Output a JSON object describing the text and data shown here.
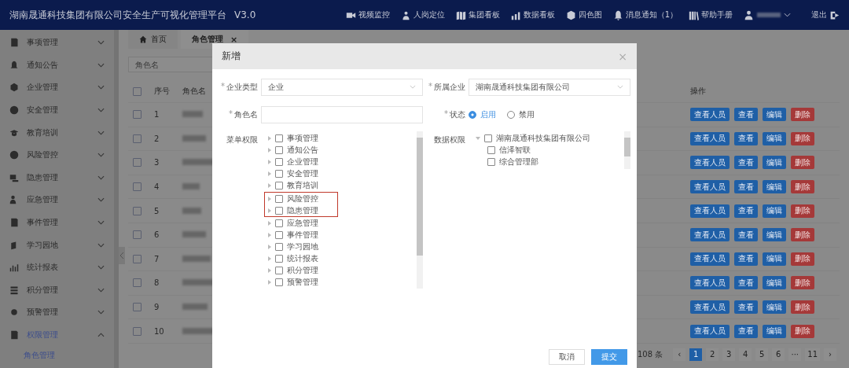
{
  "header": {
    "title": "湖南晟通科技集团有限公司安全生产可视化管理平台",
    "version": "V3.0",
    "nav": [
      {
        "label": "视频监控"
      },
      {
        "label": "人岗定位"
      },
      {
        "label": "集团看板"
      },
      {
        "label": "数据看板"
      },
      {
        "label": "四色图"
      },
      {
        "label": "消息通知（1）"
      },
      {
        "label": "帮助手册"
      }
    ],
    "logout": "退出"
  },
  "sidebar": {
    "items": [
      {
        "label": "事项管理",
        "expanded": false,
        "selected": false
      },
      {
        "label": "通知公告",
        "expanded": false,
        "selected": false
      },
      {
        "label": "企业管理",
        "expanded": false,
        "selected": false
      },
      {
        "label": "安全管理",
        "expanded": false,
        "selected": false
      },
      {
        "label": "教育培训",
        "expanded": false,
        "selected": false
      },
      {
        "label": "风险管控",
        "expanded": false,
        "selected": false
      },
      {
        "label": "隐患管理",
        "expanded": false,
        "selected": false
      },
      {
        "label": "应急管理",
        "expanded": false,
        "selected": false
      },
      {
        "label": "事件管理",
        "expanded": false,
        "selected": false
      },
      {
        "label": "学习园地",
        "expanded": false,
        "selected": false
      },
      {
        "label": "统计报表",
        "expanded": false,
        "selected": false
      },
      {
        "label": "积分管理",
        "expanded": false,
        "selected": false
      },
      {
        "label": "预警管理",
        "expanded": false,
        "selected": false
      },
      {
        "label": "权限管理",
        "expanded": true,
        "selected": true,
        "children": [
          {
            "label": "角色管理",
            "selected": true
          }
        ]
      }
    ]
  },
  "tabs": [
    {
      "label": "首页",
      "selected": false
    },
    {
      "label": "角色管理",
      "selected": true,
      "close": "×"
    }
  ],
  "search": {
    "placeholder": "角色名"
  },
  "table": {
    "all_checked": false,
    "columns": [
      "序号",
      "角色名",
      "操作"
    ],
    "rows": [
      {
        "index": "1",
        "checked": false,
        "actions": [
          {
            "label": "查看人员",
            "kind": "primary"
          },
          {
            "label": "查看",
            "kind": "primary"
          },
          {
            "label": "编辑",
            "kind": "primary"
          },
          {
            "label": "删除",
            "kind": "danger"
          }
        ]
      },
      {
        "index": "2",
        "checked": false,
        "actions": [
          {
            "label": "查看人员",
            "kind": "primary"
          },
          {
            "label": "查看",
            "kind": "primary"
          },
          {
            "label": "编辑",
            "kind": "primary"
          },
          {
            "label": "删除",
            "kind": "danger"
          }
        ]
      },
      {
        "index": "3",
        "checked": false,
        "actions": [
          {
            "label": "查看人员",
            "kind": "primary"
          },
          {
            "label": "查看",
            "kind": "primary"
          },
          {
            "label": "编辑",
            "kind": "primary"
          },
          {
            "label": "删除",
            "kind": "danger"
          }
        ]
      },
      {
        "index": "4",
        "checked": false,
        "actions": [
          {
            "label": "查看人员",
            "kind": "primary"
          },
          {
            "label": "查看",
            "kind": "primary"
          },
          {
            "label": "编辑",
            "kind": "primary"
          },
          {
            "label": "删除",
            "kind": "danger"
          }
        ]
      },
      {
        "index": "5",
        "checked": false,
        "actions": [
          {
            "label": "查看人员",
            "kind": "primary"
          },
          {
            "label": "查看",
            "kind": "primary"
          },
          {
            "label": "编辑",
            "kind": "primary"
          },
          {
            "label": "删除",
            "kind": "danger"
          }
        ]
      },
      {
        "index": "6",
        "checked": false,
        "actions": [
          {
            "label": "查看人员",
            "kind": "primary"
          },
          {
            "label": "查看",
            "kind": "primary"
          },
          {
            "label": "编辑",
            "kind": "primary"
          },
          {
            "label": "删除",
            "kind": "danger"
          }
        ]
      },
      {
        "index": "7",
        "checked": false,
        "actions": [
          {
            "label": "查看人员",
            "kind": "primary"
          },
          {
            "label": "查看",
            "kind": "primary"
          },
          {
            "label": "编辑",
            "kind": "primary"
          },
          {
            "label": "删除",
            "kind": "danger"
          }
        ]
      },
      {
        "index": "8",
        "checked": false,
        "actions": [
          {
            "label": "查看人员",
            "kind": "primary"
          },
          {
            "label": "查看",
            "kind": "primary"
          },
          {
            "label": "编辑",
            "kind": "primary"
          },
          {
            "label": "删除",
            "kind": "danger"
          }
        ]
      },
      {
        "index": "9",
        "checked": false,
        "actions": [
          {
            "label": "查看人员",
            "kind": "primary"
          },
          {
            "label": "查看",
            "kind": "primary"
          },
          {
            "label": "编辑",
            "kind": "primary"
          },
          {
            "label": "删除",
            "kind": "danger"
          }
        ]
      },
      {
        "index": "10",
        "checked": false,
        "actions": [
          {
            "label": "查看人员",
            "kind": "primary"
          },
          {
            "label": "查看",
            "kind": "primary"
          },
          {
            "label": "编辑",
            "kind": "primary"
          },
          {
            "label": "删除",
            "kind": "danger"
          }
        ]
      }
    ]
  },
  "pagination": {
    "total": "108 条",
    "prev": "‹",
    "next": "›",
    "pages": [
      {
        "label": "1",
        "selected": true
      },
      {
        "label": "2",
        "selected": false
      },
      {
        "label": "3",
        "selected": false
      },
      {
        "label": "4",
        "selected": false
      },
      {
        "label": "5",
        "selected": false
      },
      {
        "label": "6",
        "selected": false
      },
      {
        "label": "···",
        "selected": false
      },
      {
        "label": "11",
        "selected": false
      }
    ]
  },
  "modal": {
    "title": "新增",
    "close": "×",
    "company_type": {
      "mark": "*",
      "label": "企业类型",
      "value": "企业"
    },
    "company": {
      "mark": "*",
      "label": "所属企业",
      "value": "湖南晟通科技集团有限公司"
    },
    "role_name": {
      "mark": "*",
      "label": "角色名"
    },
    "status": {
      "mark": "*",
      "label": "状态",
      "options": [
        {
          "label": "启用",
          "selected": true
        },
        {
          "label": "禁用",
          "selected": false
        }
      ]
    },
    "menu_permissions": {
      "label": "菜单权限",
      "items": [
        {
          "label": "事项管理",
          "checked": false,
          "highlighted": false
        },
        {
          "label": "通知公告",
          "checked": false,
          "highlighted": false
        },
        {
          "label": "企业管理",
          "checked": false,
          "highlighted": false
        },
        {
          "label": "安全管理",
          "checked": false,
          "highlighted": false
        },
        {
          "label": "教育培训",
          "checked": false,
          "highlighted": false
        },
        {
          "label": "风险管控",
          "checked": false,
          "highlighted": true
        },
        {
          "label": "隐患管理",
          "checked": false,
          "highlighted": true
        },
        {
          "label": "应急管理",
          "checked": false,
          "highlighted": false
        },
        {
          "label": "事件管理",
          "checked": false,
          "highlighted": false
        },
        {
          "label": "学习园地",
          "checked": false,
          "highlighted": false
        },
        {
          "label": "统计报表",
          "checked": false,
          "highlighted": false
        },
        {
          "label": "积分管理",
          "checked": false,
          "highlighted": false
        },
        {
          "label": "预警管理",
          "checked": false,
          "highlighted": false
        }
      ]
    },
    "data_permissions": {
      "label": "数据权限",
      "tree": [
        {
          "label": "湖南晟通科技集团有限公司",
          "checked": false,
          "children": [
            {
              "label": "信泽智联",
              "checked": false
            },
            {
              "label": "综合管理部",
              "checked": false
            }
          ]
        }
      ]
    },
    "buttons": [
      {
        "label": "取消",
        "kind": "default"
      },
      {
        "label": "提交",
        "kind": "primary"
      }
    ]
  }
}
